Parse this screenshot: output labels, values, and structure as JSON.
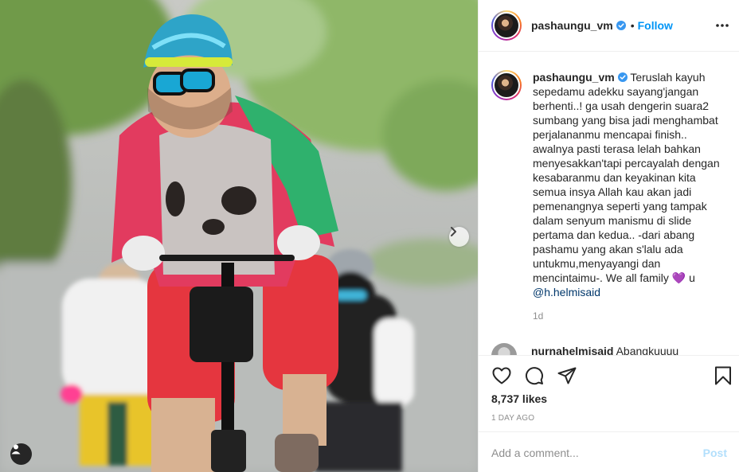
{
  "post": {
    "author": "pashaungu_vm",
    "follow_label": "Follow",
    "dot": "•",
    "caption": "Teruslah kayuh sepedamu adekku sayang'jangan berhenti..! ga usah dengerin suara2 sumbang yang bisa jadi menghambat perjalananmu mencapai finish.. awalnya pasti terasa lelah bahkan menyesakkan'tapi percayalah dengan kesabaranmu dan keyakinan kita semua insya Allah kau akan jadi pemenangnya seperti yang tampak dalam senyum manismu di slide pertama dan kedua.. -dari abang pashamu yang akan s'lalu ada untukmu,menyayangi dan mencintaimu-. We all family",
    "caption_emoji": "💜",
    "caption_tail": " u ",
    "caption_mention": "@h.helmisaid",
    "caption_age": "1d",
    "likes": "8,737 likes",
    "timestamp": "1 day ago"
  },
  "comments": [
    {
      "user": "nurnahelmisaid",
      "text": "Abangkuuuu"
    }
  ],
  "composer": {
    "placeholder": "Add a comment...",
    "post_label": "Post"
  },
  "icons": {
    "header": [
      "verified-badge-icon",
      "more-options-icon"
    ],
    "actions": [
      "heart-icon",
      "comment-icon",
      "share-icon",
      "bookmark-icon"
    ],
    "media": [
      "chevron-right-icon",
      "user-tag-icon"
    ]
  },
  "colors": {
    "link_blue": "#0095f6",
    "mention_blue": "#00376b",
    "text": "#262626",
    "muted": "#8e8e8e",
    "post_disabled": "#b2dffc",
    "border": "#efefef"
  }
}
